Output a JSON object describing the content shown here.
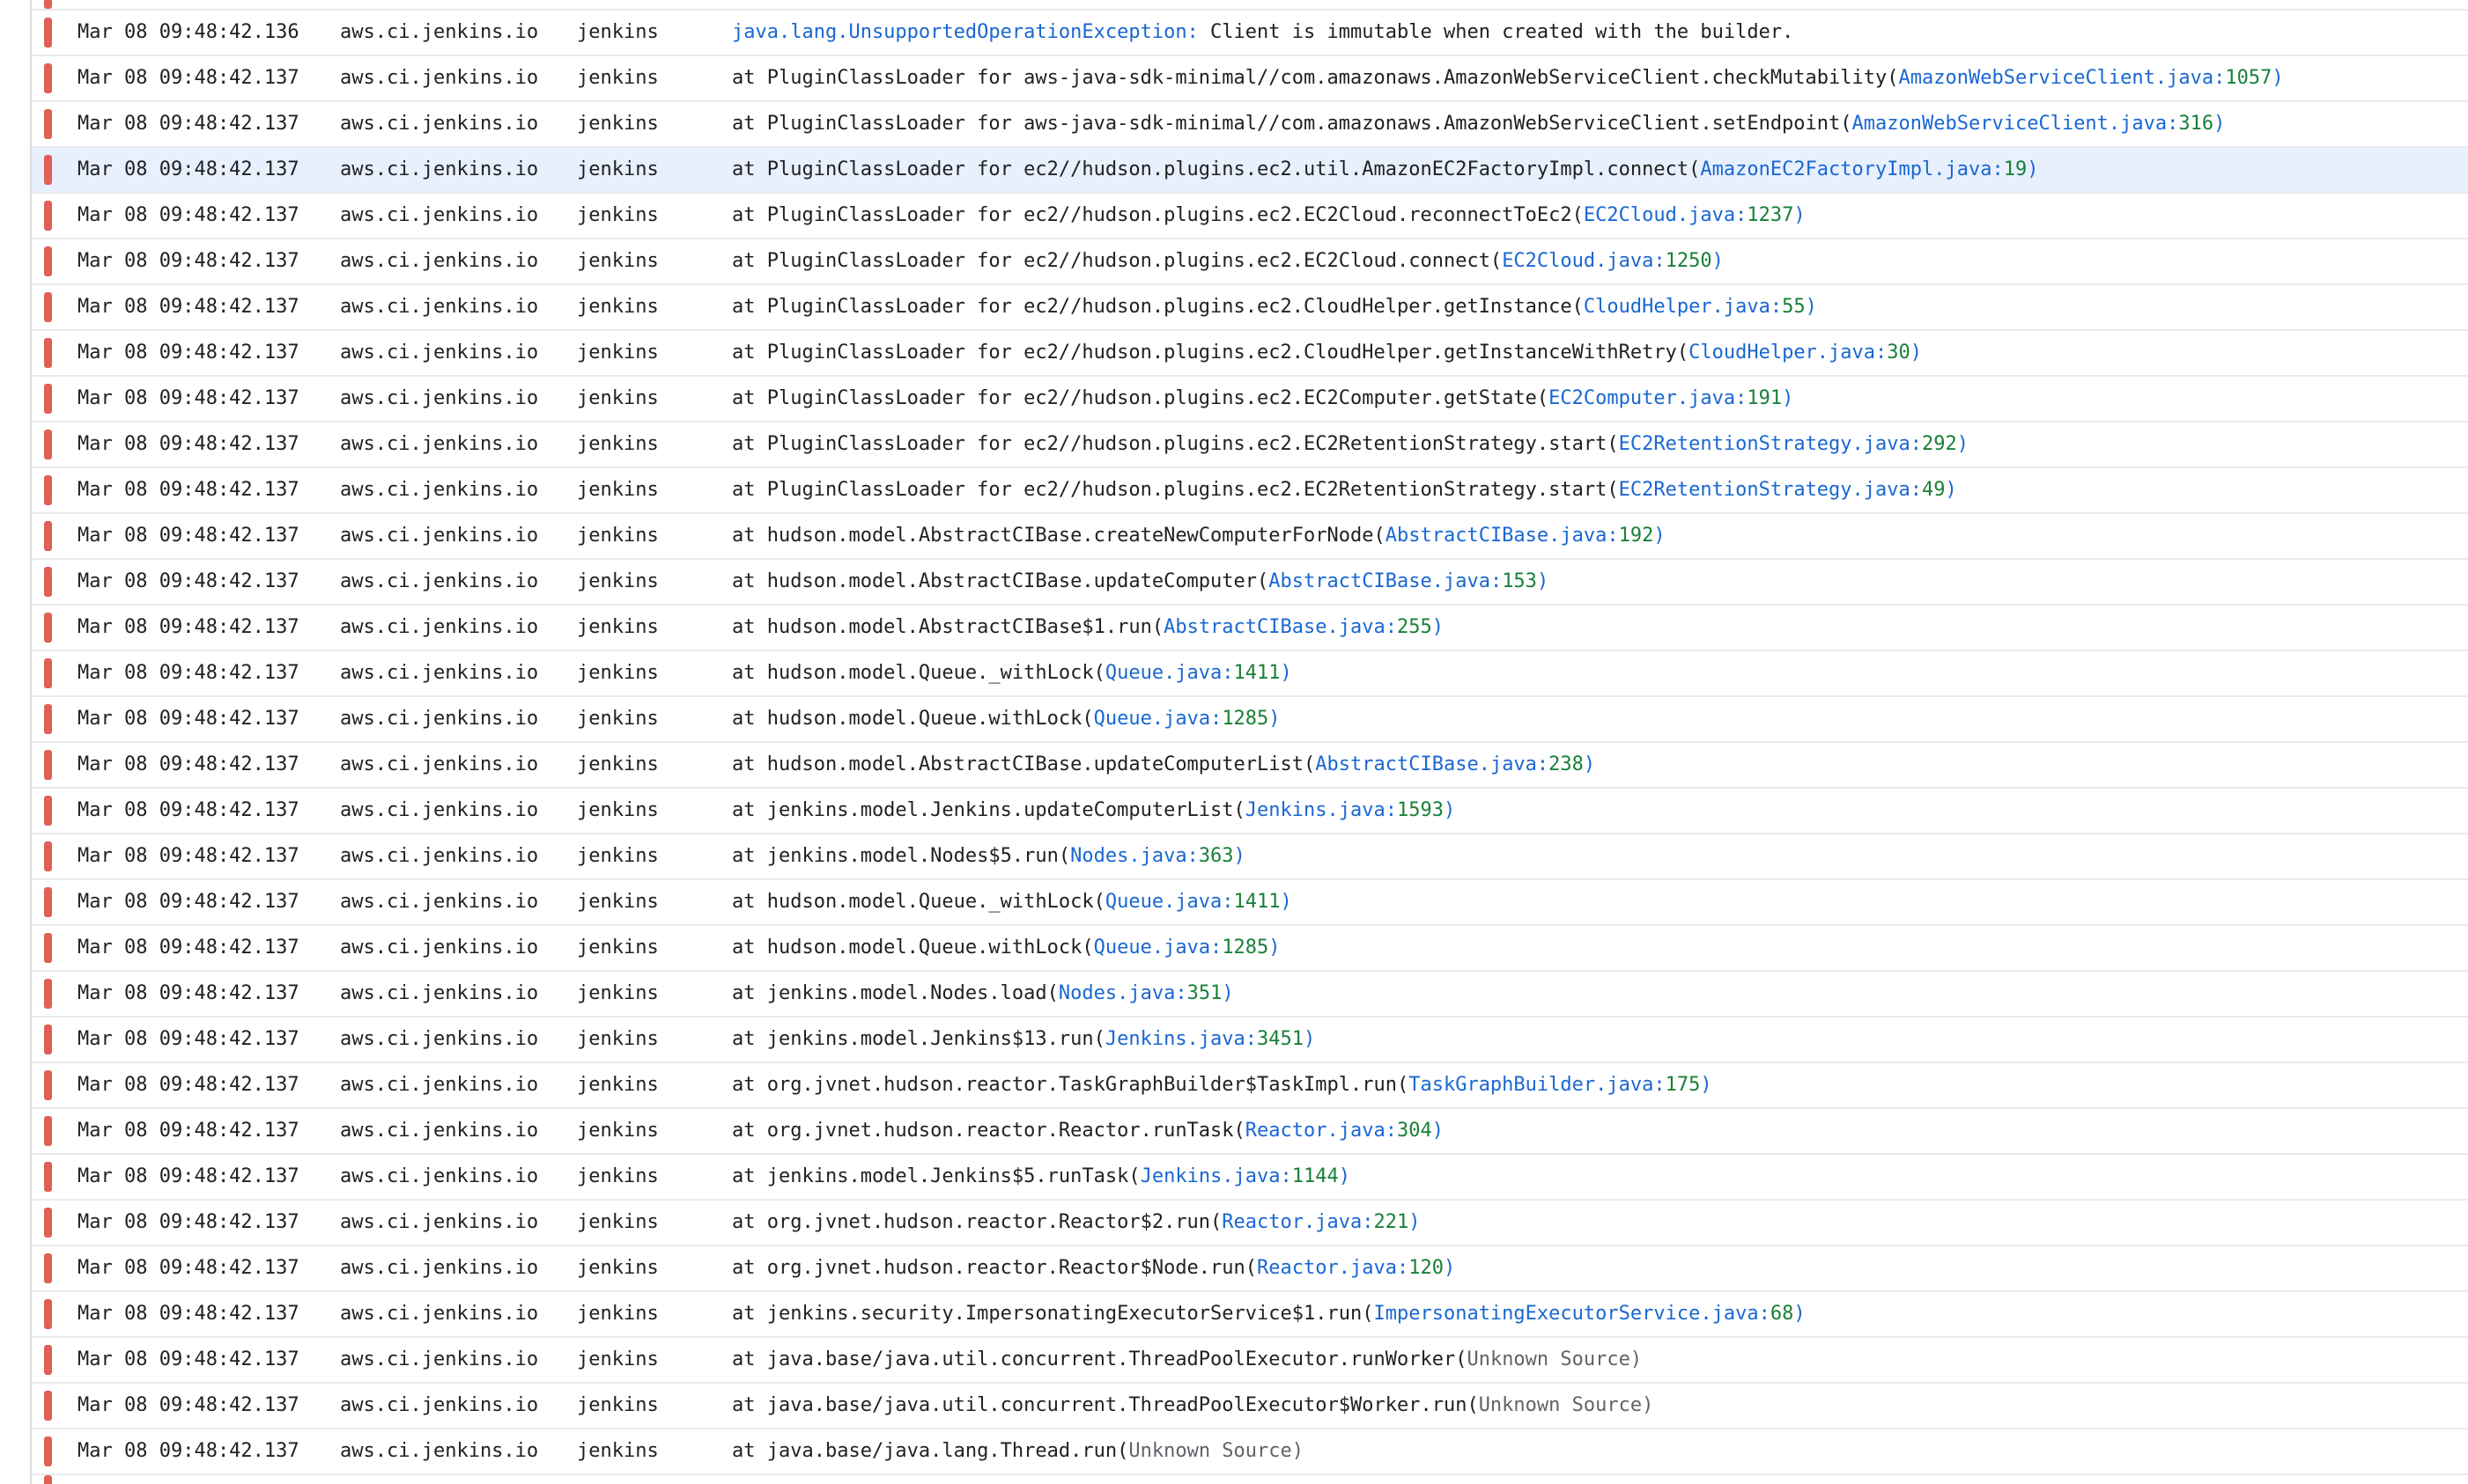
{
  "colors": {
    "severity_error": "#e06055",
    "link": "#1967d2",
    "line_number": "#188038",
    "unknown_source": "#5f6368",
    "row_border": "#e8eaed",
    "selected_row": "#e8f0fe"
  },
  "icons": {
    "severity": "severity-error-icon"
  },
  "selected_row_index": 3,
  "rows": [
    {
      "timestamp": "Mar 08 09:48:42.136",
      "host": "aws.ci.jenkins.io",
      "service": "jenkins",
      "exception_class": "java.lang.UnsupportedOperationException:",
      "exception_message": " Client is immutable when created with the builder."
    },
    {
      "timestamp": "Mar 08 09:48:42.137",
      "host": "aws.ci.jenkins.io",
      "service": "jenkins",
      "prefix": "at PluginClassLoader for aws-java-sdk-minimal//com.amazonaws.AmazonWebServiceClient.checkMutability(",
      "file": "AmazonWebServiceClient.java:",
      "line": "1057",
      "suffix": ")"
    },
    {
      "timestamp": "Mar 08 09:48:42.137",
      "host": "aws.ci.jenkins.io",
      "service": "jenkins",
      "prefix": "at PluginClassLoader for aws-java-sdk-minimal//com.amazonaws.AmazonWebServiceClient.setEndpoint(",
      "file": "AmazonWebServiceClient.java:",
      "line": "316",
      "suffix": ")"
    },
    {
      "timestamp": "Mar 08 09:48:42.137",
      "host": "aws.ci.jenkins.io",
      "service": "jenkins",
      "prefix": "at PluginClassLoader for ec2//hudson.plugins.ec2.util.AmazonEC2FactoryImpl.connect(",
      "file": "AmazonEC2FactoryImpl.java:",
      "line": "19",
      "suffix": ")"
    },
    {
      "timestamp": "Mar 08 09:48:42.137",
      "host": "aws.ci.jenkins.io",
      "service": "jenkins",
      "prefix": "at PluginClassLoader for ec2//hudson.plugins.ec2.EC2Cloud.reconnectToEc2(",
      "file": "EC2Cloud.java:",
      "line": "1237",
      "suffix": ")"
    },
    {
      "timestamp": "Mar 08 09:48:42.137",
      "host": "aws.ci.jenkins.io",
      "service": "jenkins",
      "prefix": "at PluginClassLoader for ec2//hudson.plugins.ec2.EC2Cloud.connect(",
      "file": "EC2Cloud.java:",
      "line": "1250",
      "suffix": ")"
    },
    {
      "timestamp": "Mar 08 09:48:42.137",
      "host": "aws.ci.jenkins.io",
      "service": "jenkins",
      "prefix": "at PluginClassLoader for ec2//hudson.plugins.ec2.CloudHelper.getInstance(",
      "file": "CloudHelper.java:",
      "line": "55",
      "suffix": ")"
    },
    {
      "timestamp": "Mar 08 09:48:42.137",
      "host": "aws.ci.jenkins.io",
      "service": "jenkins",
      "prefix": "at PluginClassLoader for ec2//hudson.plugins.ec2.CloudHelper.getInstanceWithRetry(",
      "file": "CloudHelper.java:",
      "line": "30",
      "suffix": ")"
    },
    {
      "timestamp": "Mar 08 09:48:42.137",
      "host": "aws.ci.jenkins.io",
      "service": "jenkins",
      "prefix": "at PluginClassLoader for ec2//hudson.plugins.ec2.EC2Computer.getState(",
      "file": "EC2Computer.java:",
      "line": "191",
      "suffix": ")"
    },
    {
      "timestamp": "Mar 08 09:48:42.137",
      "host": "aws.ci.jenkins.io",
      "service": "jenkins",
      "prefix": "at PluginClassLoader for ec2//hudson.plugins.ec2.EC2RetentionStrategy.start(",
      "file": "EC2RetentionStrategy.java:",
      "line": "292",
      "suffix": ")"
    },
    {
      "timestamp": "Mar 08 09:48:42.137",
      "host": "aws.ci.jenkins.io",
      "service": "jenkins",
      "prefix": "at PluginClassLoader for ec2//hudson.plugins.ec2.EC2RetentionStrategy.start(",
      "file": "EC2RetentionStrategy.java:",
      "line": "49",
      "suffix": ")"
    },
    {
      "timestamp": "Mar 08 09:48:42.137",
      "host": "aws.ci.jenkins.io",
      "service": "jenkins",
      "prefix": "at hudson.model.AbstractCIBase.createNewComputerForNode(",
      "file": "AbstractCIBase.java:",
      "line": "192",
      "suffix": ")"
    },
    {
      "timestamp": "Mar 08 09:48:42.137",
      "host": "aws.ci.jenkins.io",
      "service": "jenkins",
      "prefix": "at hudson.model.AbstractCIBase.updateComputer(",
      "file": "AbstractCIBase.java:",
      "line": "153",
      "suffix": ")"
    },
    {
      "timestamp": "Mar 08 09:48:42.137",
      "host": "aws.ci.jenkins.io",
      "service": "jenkins",
      "prefix": "at hudson.model.AbstractCIBase$1.run(",
      "file": "AbstractCIBase.java:",
      "line": "255",
      "suffix": ")"
    },
    {
      "timestamp": "Mar 08 09:48:42.137",
      "host": "aws.ci.jenkins.io",
      "service": "jenkins",
      "prefix": "at hudson.model.Queue._withLock(",
      "file": "Queue.java:",
      "line": "1411",
      "suffix": ")"
    },
    {
      "timestamp": "Mar 08 09:48:42.137",
      "host": "aws.ci.jenkins.io",
      "service": "jenkins",
      "prefix": "at hudson.model.Queue.withLock(",
      "file": "Queue.java:",
      "line": "1285",
      "suffix": ")"
    },
    {
      "timestamp": "Mar 08 09:48:42.137",
      "host": "aws.ci.jenkins.io",
      "service": "jenkins",
      "prefix": "at hudson.model.AbstractCIBase.updateComputerList(",
      "file": "AbstractCIBase.java:",
      "line": "238",
      "suffix": ")"
    },
    {
      "timestamp": "Mar 08 09:48:42.137",
      "host": "aws.ci.jenkins.io",
      "service": "jenkins",
      "prefix": "at jenkins.model.Jenkins.updateComputerList(",
      "file": "Jenkins.java:",
      "line": "1593",
      "suffix": ")"
    },
    {
      "timestamp": "Mar 08 09:48:42.137",
      "host": "aws.ci.jenkins.io",
      "service": "jenkins",
      "prefix": "at jenkins.model.Nodes$5.run(",
      "file": "Nodes.java:",
      "line": "363",
      "suffix": ")"
    },
    {
      "timestamp": "Mar 08 09:48:42.137",
      "host": "aws.ci.jenkins.io",
      "service": "jenkins",
      "prefix": "at hudson.model.Queue._withLock(",
      "file": "Queue.java:",
      "line": "1411",
      "suffix": ")"
    },
    {
      "timestamp": "Mar 08 09:48:42.137",
      "host": "aws.ci.jenkins.io",
      "service": "jenkins",
      "prefix": "at hudson.model.Queue.withLock(",
      "file": "Queue.java:",
      "line": "1285",
      "suffix": ")"
    },
    {
      "timestamp": "Mar 08 09:48:42.137",
      "host": "aws.ci.jenkins.io",
      "service": "jenkins",
      "prefix": "at jenkins.model.Nodes.load(",
      "file": "Nodes.java:",
      "line": "351",
      "suffix": ")"
    },
    {
      "timestamp": "Mar 08 09:48:42.137",
      "host": "aws.ci.jenkins.io",
      "service": "jenkins",
      "prefix": "at jenkins.model.Jenkins$13.run(",
      "file": "Jenkins.java:",
      "line": "3451",
      "suffix": ")"
    },
    {
      "timestamp": "Mar 08 09:48:42.137",
      "host": "aws.ci.jenkins.io",
      "service": "jenkins",
      "prefix": "at org.jvnet.hudson.reactor.TaskGraphBuilder$TaskImpl.run(",
      "file": "TaskGraphBuilder.java:",
      "line": "175",
      "suffix": ")"
    },
    {
      "timestamp": "Mar 08 09:48:42.137",
      "host": "aws.ci.jenkins.io",
      "service": "jenkins",
      "prefix": "at org.jvnet.hudson.reactor.Reactor.runTask(",
      "file": "Reactor.java:",
      "line": "304",
      "suffix": ")"
    },
    {
      "timestamp": "Mar 08 09:48:42.137",
      "host": "aws.ci.jenkins.io",
      "service": "jenkins",
      "prefix": "at jenkins.model.Jenkins$5.runTask(",
      "file": "Jenkins.java:",
      "line": "1144",
      "suffix": ")"
    },
    {
      "timestamp": "Mar 08 09:48:42.137",
      "host": "aws.ci.jenkins.io",
      "service": "jenkins",
      "prefix": "at org.jvnet.hudson.reactor.Reactor$2.run(",
      "file": "Reactor.java:",
      "line": "221",
      "suffix": ")"
    },
    {
      "timestamp": "Mar 08 09:48:42.137",
      "host": "aws.ci.jenkins.io",
      "service": "jenkins",
      "prefix": "at org.jvnet.hudson.reactor.Reactor$Node.run(",
      "file": "Reactor.java:",
      "line": "120",
      "suffix": ")"
    },
    {
      "timestamp": "Mar 08 09:48:42.137",
      "host": "aws.ci.jenkins.io",
      "service": "jenkins",
      "prefix": "at jenkins.security.ImpersonatingExecutorService$1.run(",
      "file": "ImpersonatingExecutorService.java:",
      "line": "68",
      "suffix": ")"
    },
    {
      "timestamp": "Mar 08 09:48:42.137",
      "host": "aws.ci.jenkins.io",
      "service": "jenkins",
      "prefix": "at java.base/java.util.concurrent.ThreadPoolExecutor.runWorker(",
      "unknown": "Unknown Source",
      "suffix": ")"
    },
    {
      "timestamp": "Mar 08 09:48:42.137",
      "host": "aws.ci.jenkins.io",
      "service": "jenkins",
      "prefix": "at java.base/java.util.concurrent.ThreadPoolExecutor$Worker.run(",
      "unknown": "Unknown Source",
      "suffix": ")"
    },
    {
      "timestamp": "Mar 08 09:48:42.137",
      "host": "aws.ci.jenkins.io",
      "service": "jenkins",
      "prefix": "at java.base/java.lang.Thread.run(",
      "unknown": "Unknown Source",
      "suffix": ")"
    }
  ]
}
